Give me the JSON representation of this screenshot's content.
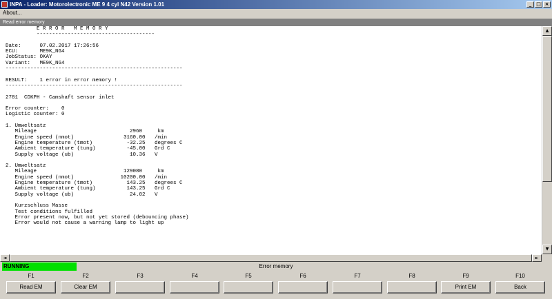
{
  "window": {
    "title": "INPA - Loader: Motorolectronic ME 9  4 cyl N42 Version 1.01",
    "minimize": "_",
    "maximize": "□",
    "close": "×"
  },
  "menu": {
    "about": "About..."
  },
  "panel": {
    "title": "Read error memory"
  },
  "report": {
    "lines": [
      "          E R R O R   M E M O R Y",
      "          --------------------------------------",
      "",
      "Date:      07.02.2017 17:26:56",
      "ECU:       ME9K_NG4",
      "JobStatus: OKAY",
      "Variant:   ME9K_NG4",
      "---------------------------------------------------------",
      "",
      "RESULT:    1 error in error memory !",
      "---------------------------------------------------------",
      "",
      "2781  CDKPH - Camshaft sensor inlet",
      "",
      "Error counter:    0",
      "Logistic counter: 0",
      "",
      "1. Umweltsatz",
      "   Mileage                              2960     km",
      "   Engine speed (nmot)                3160.00   /min",
      "   Engine temperature (tmot)           -32.25   degrees C",
      "   Ambient temperature (tung)          -45.00   Grd C",
      "   Supply voltage (ub)                  10.36   V",
      "",
      "2. Umweltsatz",
      "   Mileage                            129080     km",
      "   Engine speed (nmot)               10200.00   /min",
      "   Engine temperature (tmot)           143.25   degrees C",
      "   Ambient temperature (tung)          143.25   Grd C",
      "   Supply voltage (ub)                  24.02   V",
      "",
      "   Kurzschluss Masse",
      "   Test conditions fulfilled",
      "   Error present now, but not yet stored (debouncing phase)",
      "   Error would not cause a warning lamp to light up"
    ]
  },
  "scroll": {
    "up": "▲",
    "down": "▼",
    "left": "◄",
    "right": "►"
  },
  "status": {
    "state": "RUNNING",
    "screen_title": "Error memory",
    "state_color": "#00e000"
  },
  "function_keys": [
    {
      "key": "F1",
      "label": "Read EM"
    },
    {
      "key": "F2",
      "label": "Clear EM"
    },
    {
      "key": "F3",
      "label": ""
    },
    {
      "key": "F4",
      "label": ""
    },
    {
      "key": "F5",
      "label": ""
    },
    {
      "key": "F6",
      "label": ""
    },
    {
      "key": "F7",
      "label": ""
    },
    {
      "key": "F8",
      "label": ""
    },
    {
      "key": "F9",
      "label": "Print EM"
    },
    {
      "key": "F10",
      "label": "Back"
    }
  ]
}
